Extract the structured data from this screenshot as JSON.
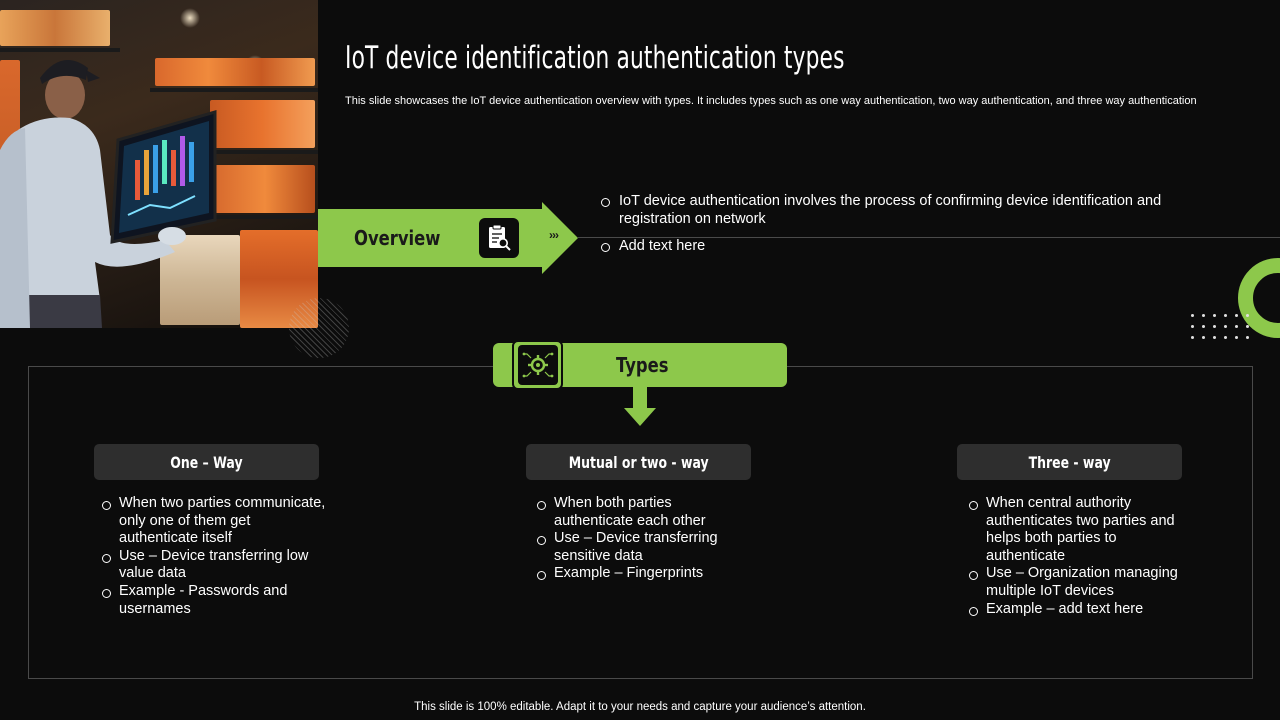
{
  "title": "IoT device identification authentication types",
  "subtitle": "This slide showcases the IoT device authentication overview with types. It includes types such as one way authentication, two way authentication, and three way authentication",
  "overview": {
    "label": "Overview",
    "chevrons": "›››",
    "icon": "clipboard-search-icon",
    "points": [
      "IoT device authentication involves the process of confirming device identification and registration on network",
      "Add text here"
    ]
  },
  "types": {
    "label": "Types",
    "icon": "gear-circuit-icon",
    "columns": [
      {
        "heading": "One – Way",
        "points": [
          "When two parties communicate, only one of them get authenticate itself",
          "Use – Device transferring low value data",
          "Example -  Passwords and usernames"
        ]
      },
      {
        "heading": "Mutual  or two - way",
        "points": [
          "When both parties authenticate each other",
          "Use –  Device transferring sensitive data",
          "Example – Fingerprints"
        ]
      },
      {
        "heading": "Three  - way",
        "points": [
          "When central authority authenticates two parties and helps both parties to authenticate",
          "Use – Organization managing multiple IoT devices",
          "Example – add text here"
        ]
      }
    ]
  },
  "footer": "This slide is 100% editable. Adapt it to your needs and capture your audience’s attention.",
  "colors": {
    "accent": "#8dc84b",
    "background": "#0c0c0c",
    "card": "#2e2e2e"
  }
}
